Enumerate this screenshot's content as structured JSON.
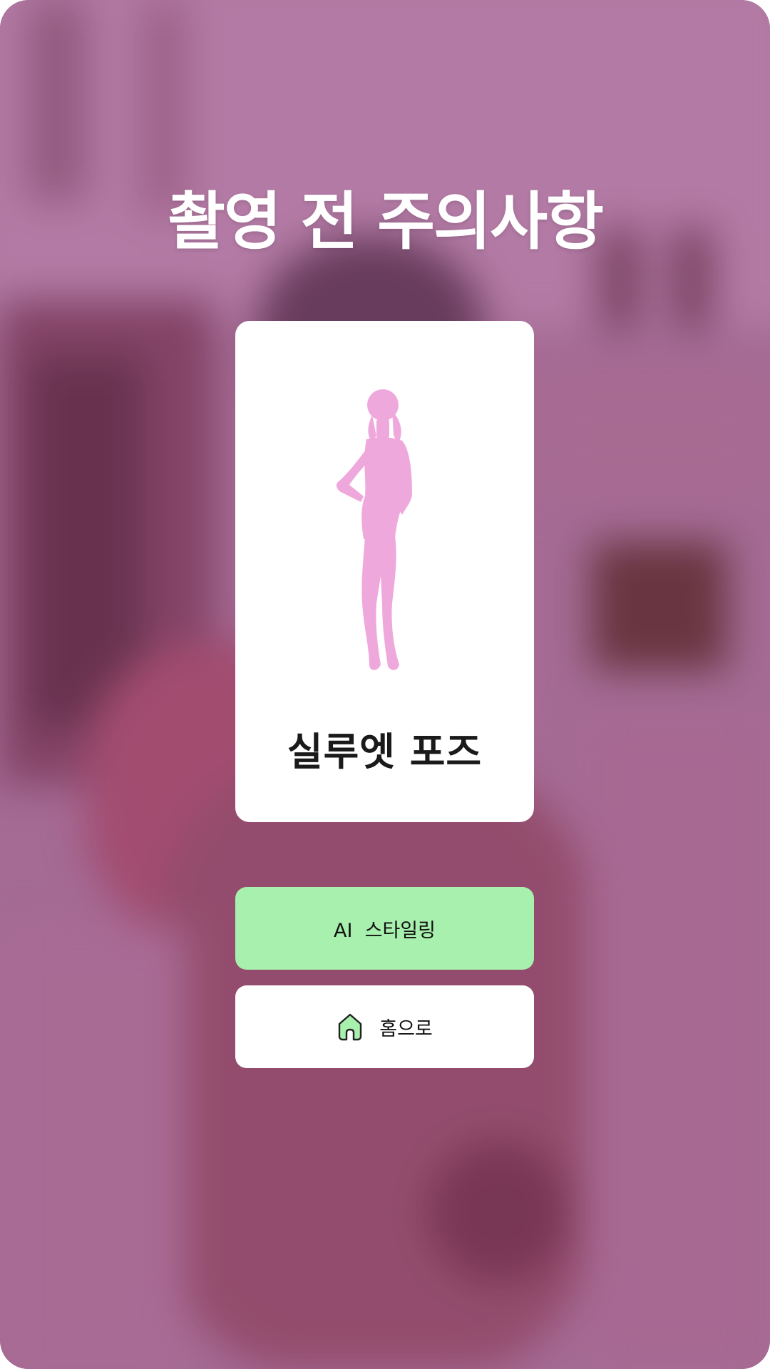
{
  "title": "촬영 전 주의사항",
  "card": {
    "pose_name": "실루엣 포즈",
    "silhouette_color": "#efa8dc",
    "silhouette_icon": "woman-silhouette-icon"
  },
  "buttons": {
    "ai_styling_label": "AI  스타일링",
    "home_label": "홈으로",
    "home_icon": "house-icon"
  },
  "colors": {
    "primary_button": "#a8f0ad",
    "background_tint": "#a46f94"
  }
}
